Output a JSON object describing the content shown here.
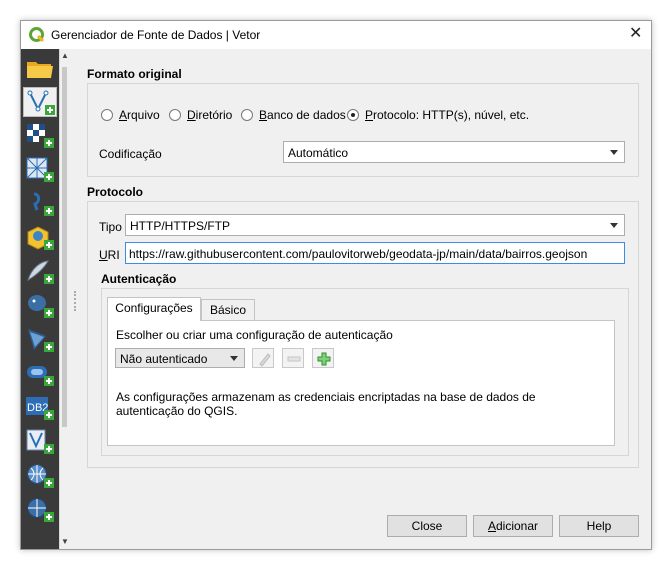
{
  "window": {
    "title": "Gerenciador de Fonte de Dados | Vetor"
  },
  "sidebar": {
    "items": [
      {
        "icon": "folder-icon"
      },
      {
        "icon": "vector-layer-icon",
        "selected": true
      },
      {
        "icon": "raster-layer-icon"
      },
      {
        "icon": "mesh-layer-icon"
      },
      {
        "icon": "delimited-text-icon"
      },
      {
        "icon": "geopackage-icon"
      },
      {
        "icon": "spatialite-icon"
      },
      {
        "icon": "postgis-icon"
      },
      {
        "icon": "mssql-icon"
      },
      {
        "icon": "oracle-icon"
      },
      {
        "icon": "db2-icon",
        "text": "DB2"
      },
      {
        "icon": "virtual-layer-icon"
      },
      {
        "icon": "wms-icon"
      },
      {
        "icon": "wfs-icon"
      }
    ]
  },
  "source_type": {
    "title": "Formato original",
    "options": [
      {
        "pre": "",
        "acc": "A",
        "post": "rquivo",
        "selected": false
      },
      {
        "pre": "",
        "acc": "D",
        "post": "iretório",
        "selected": false
      },
      {
        "pre": "",
        "acc": "B",
        "post": "anco de dados",
        "selected": false
      },
      {
        "pre": "",
        "acc": "P",
        "post": "rotocolo: HTTP(s), núvel, etc.",
        "selected": true
      }
    ],
    "encoding_label": "Codificação",
    "encoding_value": "Automático"
  },
  "protocol": {
    "title": "Protocolo",
    "type_label": "Tipo",
    "type_value": "HTTP/HTTPS/FTP",
    "uri_label_acc": "U",
    "uri_label_rest": "RI",
    "uri_value": "https://raw.githubusercontent.com/paulovitorweb/geodata-jp/main/data/bairros.geojson"
  },
  "auth": {
    "title": "Autenticação",
    "tabs": [
      "Configurações",
      "Básico"
    ],
    "prompt": "Escolher ou criar uma configuração de autenticação",
    "config_value": "Não autenticado",
    "note": "As configurações armazenam as credenciais encriptadas na base de dados de autenticação do QGIS."
  },
  "buttons": {
    "close": "Close",
    "add_acc": "A",
    "add_rest": "dicionar",
    "help": "Help"
  },
  "colors": {
    "accent": "#3c8de0",
    "sidebar_bg": "#3a3a3a",
    "plus_green": "#3aa73a"
  }
}
